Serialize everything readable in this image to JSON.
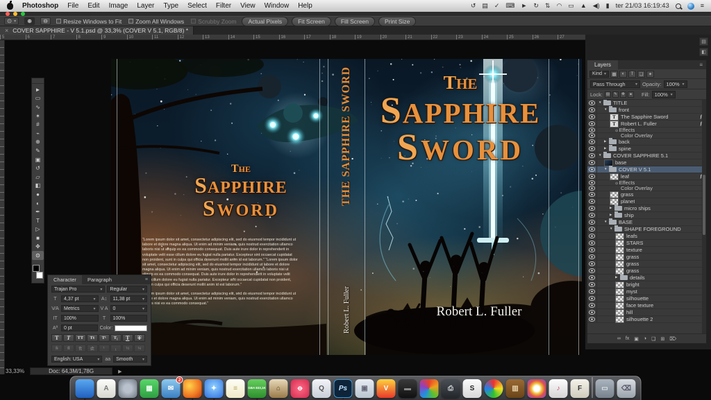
{
  "menubar": {
    "items": [
      {
        "label": "Photoshop",
        "cls": "bold"
      },
      {
        "label": "File",
        "cls": ""
      },
      {
        "label": "Edit",
        "cls": ""
      },
      {
        "label": "Image",
        "cls": ""
      },
      {
        "label": "Layer",
        "cls": ""
      },
      {
        "label": "Type",
        "cls": ""
      },
      {
        "label": "Select",
        "cls": ""
      },
      {
        "label": "Filter",
        "cls": ""
      },
      {
        "label": "View",
        "cls": ""
      },
      {
        "label": "Window",
        "cls": ""
      },
      {
        "label": "Help",
        "cls": ""
      }
    ],
    "status_icons": [
      {
        "name": "time-machine-icon",
        "glyph": "↺"
      },
      {
        "name": "display-icon",
        "glyph": "▤"
      },
      {
        "name": "dropbox-icon",
        "glyph": "✓"
      },
      {
        "name": "keyboard-icon",
        "glyph": "⌨"
      },
      {
        "name": "pointer-icon",
        "glyph": "►"
      },
      {
        "name": "sync-icon",
        "glyph": "↻"
      },
      {
        "name": "updown-icon",
        "glyph": "⇅"
      },
      {
        "name": "wifi-icon",
        "glyph": "◠"
      },
      {
        "name": "screen-share-icon",
        "glyph": "▭"
      },
      {
        "name": "eject-icon",
        "glyph": "▲"
      },
      {
        "name": "volume-icon",
        "glyph": "◀)"
      },
      {
        "name": "battery-icon",
        "glyph": "▮"
      }
    ],
    "clock": "ter 21/03 16:19:43",
    "notification_glyph": "≡"
  },
  "options": {
    "tool_glyph": "⊙",
    "zoom_in_glyph": "⊕",
    "zoom_out_glyph": "⊖",
    "checkboxes": [
      {
        "label": "Resize Windows to Fit",
        "cls": ""
      },
      {
        "label": "Zoom All Windows",
        "cls": ""
      },
      {
        "label": "Scrubby Zoom",
        "cls": "dim"
      }
    ],
    "buttons": [
      {
        "label": "Actual Pixels"
      },
      {
        "label": "Fit Screen"
      },
      {
        "label": "Fill Screen"
      },
      {
        "label": "Print Size"
      }
    ]
  },
  "tab": {
    "close": "×",
    "title": "COVER SAPPHIRE - V 5.1.psd @ 33,3% (COVER V 5.1, RGB/8) *"
  },
  "ruler": {
    "numbers": [
      "5",
      "6",
      "7",
      "8",
      "9",
      "10",
      "11",
      "12",
      "13",
      "14",
      "15",
      "16",
      "17",
      "18",
      "19",
      "20",
      "21",
      "22",
      "23",
      "24",
      "25",
      "26",
      "27"
    ]
  },
  "toolbar": {
    "tools": [
      {
        "name": "move-tool",
        "glyph": "►",
        "cls": ""
      },
      {
        "name": "marquee-tool",
        "glyph": "▭",
        "cls": ""
      },
      {
        "name": "lasso-tool",
        "glyph": "∿",
        "cls": ""
      },
      {
        "name": "quick-select-tool",
        "glyph": "✶",
        "cls": ""
      },
      {
        "name": "crop-tool",
        "glyph": "#",
        "cls": ""
      },
      {
        "name": "eyedropper-tool",
        "glyph": "⌁",
        "cls": ""
      },
      {
        "name": "healing-brush-tool",
        "glyph": "⊕",
        "cls": ""
      },
      {
        "name": "brush-tool",
        "glyph": "✎",
        "cls": ""
      },
      {
        "name": "clone-stamp-tool",
        "glyph": "▣",
        "cls": ""
      },
      {
        "name": "history-brush-tool",
        "glyph": "↺",
        "cls": ""
      },
      {
        "name": "eraser-tool",
        "glyph": "▱",
        "cls": ""
      },
      {
        "name": "gradient-tool",
        "glyph": "◧",
        "cls": ""
      },
      {
        "name": "blur-tool",
        "glyph": "●",
        "cls": ""
      },
      {
        "name": "dodge-tool",
        "glyph": "◐",
        "cls": ""
      },
      {
        "name": "pen-tool",
        "glyph": "✒",
        "cls": ""
      },
      {
        "name": "type-tool",
        "glyph": "T",
        "cls": ""
      },
      {
        "name": "path-select-tool",
        "glyph": "▷",
        "cls": ""
      },
      {
        "name": "shape-tool",
        "glyph": "■",
        "cls": ""
      },
      {
        "name": "hand-tool",
        "glyph": "✥",
        "cls": ""
      },
      {
        "name": "zoom-tool",
        "glyph": "⊙",
        "cls": "active"
      }
    ]
  },
  "cover": {
    "front": {
      "the": "THE",
      "title1": "SAPPHIRE",
      "title2": "SWORD",
      "author": "Robert L. Fuller"
    },
    "back": {
      "the": "THE",
      "title1": "SAPPHIRE",
      "title2": "SWORD",
      "body_p1": "“Lorem ipsum dolor sit amet, consectetur adipiscing elit, sed do eiusmod tempor incididunt ut labore et dolore magna aliqua. Ut enim ad minim veniam, quis nostrud exercitation ullamco laboris nisi ut aliquip ex ea commodo consequat. Duis aute irure dolor in reprehenderit in voluptate velit esse cillum dolore eu fugiat nulla pariatur. Excepteur sint occaecat cupidatat non proident, sunt in culpa qui officia deserunt mollit anim id est laborum.” “Lorem ipsum dolor sit amet, consectetur adipiscing elit, sed do eiusmod tempor incididunt ut labore et dolore magna aliqua. Ut enim ad minim veniam, quis nostrud exercitation ullamco laboris nisi ut aliquip ex ea commodo consequat. Duis aute irure dolor in reprehenderit in voluptate velit esse cillum dolore eu fugiat nulla pariatur. Excepteur sint occaecat cupidatat non proident, sunt in culpa qui officia deserunt mollit anim id est laborum.”",
      "body_p2": "“Lorem ipsum dolor sit amet, consectetur adipiscing elit, sed do eiusmod tempor incididunt ut labore et dolore magna aliqua. Ut enim ad minim veniam, quis nostrud exercitation ullamco laboris nisi ex ea commodo consequat.”"
    },
    "spine": {
      "title": "THE SAPPHIRE SWORD",
      "author": "Robert L. Fuller"
    }
  },
  "character_panel": {
    "tab_character": "Character",
    "tab_paragraph": "Paragraph",
    "font_family": "Trajan Pro",
    "font_style": "Regular",
    "size": "4,37 pt",
    "leading": "11,38 pt",
    "kerning": "Metrics",
    "tracking": "0",
    "v_scale": "100%",
    "h_scale": "100%",
    "baseline": "0 pt",
    "color_label": "Color:",
    "language": "English: USA",
    "antialias_label": "aa",
    "antialias": "Smooth",
    "toggles_row1": [
      {
        "g": "T",
        "cls": ""
      },
      {
        "g": "T",
        "cls": "i"
      },
      {
        "g": "TT",
        "cls": "sm"
      },
      {
        "g": "Tt",
        "cls": "sm"
      },
      {
        "g": "T¹",
        "cls": "sm"
      },
      {
        "g": "T₁",
        "cls": "sm"
      },
      {
        "g": "T",
        "cls": "u"
      },
      {
        "g": "T",
        "cls": "s"
      }
    ],
    "toggles_row2": [
      {
        "g": "ﬁ",
        "cls": "dim sm"
      },
      {
        "g": "ﬂ",
        "cls": "dim sm"
      },
      {
        "g": "ﬅ",
        "cls": "dim sm"
      },
      {
        "g": "ﬆ",
        "cls": "dim sm"
      },
      {
        "g": "¹",
        "cls": "dim sm"
      },
      {
        "g": "₁",
        "cls": "dim sm"
      },
      {
        "g": "½",
        "cls": "dim sm"
      },
      {
        "g": "¼",
        "cls": "dim sm"
      }
    ]
  },
  "layers_panel": {
    "tab": "Layers",
    "menu_glyph": "≡",
    "filter_label": "Kind",
    "filter_icons": [
      {
        "name": "filter-pixel-icon",
        "glyph": "▩"
      },
      {
        "name": "filter-adjustment-icon",
        "glyph": "◐"
      },
      {
        "name": "filter-type-icon",
        "glyph": "T"
      },
      {
        "name": "filter-shape-icon",
        "glyph": "❏"
      },
      {
        "name": "filter-smart-icon",
        "glyph": "✦"
      }
    ],
    "blend_mode": "Pass Through",
    "opacity_label": "Opacity:",
    "opacity": "100%",
    "lock_label": "Lock:",
    "lock_icons": [
      {
        "name": "lock-transparent-icon",
        "glyph": "▨"
      },
      {
        "name": "lock-pixels-icon",
        "glyph": "✎"
      },
      {
        "name": "lock-position-icon",
        "glyph": "✥"
      },
      {
        "name": "lock-all-icon",
        "glyph": "∎"
      }
    ],
    "fill_label": "Fill:",
    "fill": "100%",
    "fx_label": "fx",
    "rows": [
      {
        "label": "TITLE",
        "lv": "lv0",
        "kind": "group-open",
        "fx": "",
        "sel": ""
      },
      {
        "label": "front",
        "lv": "lv1",
        "kind": "group-open",
        "fx": "",
        "sel": ""
      },
      {
        "label": "The Sapphire Sword",
        "lv": "lv2",
        "kind": "text",
        "fx": "hasfx",
        "sel": ""
      },
      {
        "label": "Robert L. Fuller",
        "lv": "lv2",
        "kind": "text",
        "fx": "hasfx",
        "sel": ""
      },
      {
        "label": "Effects",
        "lv": "lv3",
        "kind": "effects",
        "fx": "",
        "sel": ""
      },
      {
        "label": "Color Overlay",
        "lv": "lv4",
        "kind": "overlay",
        "fx": "",
        "sel": ""
      },
      {
        "label": "back",
        "lv": "lv1",
        "kind": "group-closed",
        "fx": "",
        "sel": ""
      },
      {
        "label": "spine",
        "lv": "lv1",
        "kind": "group-closed",
        "fx": "",
        "sel": ""
      },
      {
        "label": "COVER SAPPHIRE 5.1",
        "lv": "lv0",
        "kind": "group-open",
        "fx": "",
        "sel": ""
      },
      {
        "label": "base",
        "lv": "lv1",
        "kind": "image",
        "fx": "",
        "sel": ""
      },
      {
        "label": "COVER V 5.1",
        "lv": "lv1",
        "kind": "group-open",
        "fx": "",
        "sel": "selected"
      },
      {
        "label": "leaf",
        "lv": "lv2",
        "kind": "thumb",
        "fx": "hasfx",
        "sel": ""
      },
      {
        "label": "Effects",
        "lv": "lv3",
        "kind": "effects",
        "fx": "",
        "sel": ""
      },
      {
        "label": "Color Overlay",
        "lv": "lv4",
        "kind": "overlay",
        "fx": "",
        "sel": ""
      },
      {
        "label": "grass",
        "lv": "lv2",
        "kind": "thumb",
        "fx": "",
        "sel": ""
      },
      {
        "label": "planet",
        "lv": "lv2",
        "kind": "thumb",
        "fx": "",
        "sel": ""
      },
      {
        "label": "micro ships",
        "lv": "lv2",
        "kind": "group-closed",
        "fx": "",
        "sel": ""
      },
      {
        "label": "ship",
        "lv": "lv2",
        "kind": "group-closed",
        "fx": "",
        "sel": ""
      },
      {
        "label": "BASE",
        "lv": "lv1",
        "kind": "group-open",
        "fx": "",
        "sel": ""
      },
      {
        "label": "SHAPE FOREGROUND",
        "lv": "lv2",
        "kind": "group-open",
        "fx": "",
        "sel": ""
      },
      {
        "label": "leafs",
        "lv": "lv3",
        "kind": "thumb",
        "fx": "",
        "sel": ""
      },
      {
        "label": "STARS",
        "lv": "lv3",
        "kind": "thumb",
        "fx": "",
        "sel": ""
      },
      {
        "label": "texture",
        "lv": "lv3",
        "kind": "thumb",
        "fx": "",
        "sel": ""
      },
      {
        "label": "grass",
        "lv": "lv3",
        "kind": "thumb",
        "fx": "",
        "sel": ""
      },
      {
        "label": "grass",
        "lv": "lv3",
        "kind": "thumb",
        "fx": "",
        "sel": ""
      },
      {
        "label": "grass",
        "lv": "lv3",
        "kind": "thumb",
        "fx": "",
        "sel": ""
      },
      {
        "label": "details",
        "lv": "lv3",
        "kind": "group-closed",
        "fx": "",
        "sel": ""
      },
      {
        "label": "bright",
        "lv": "lv3",
        "kind": "thumb",
        "fx": "",
        "sel": ""
      },
      {
        "label": "myst",
        "lv": "lv3",
        "kind": "thumb",
        "fx": "",
        "sel": ""
      },
      {
        "label": "silhouette",
        "lv": "lv3",
        "kind": "thumb",
        "fx": "",
        "sel": ""
      },
      {
        "label": "face texture",
        "lv": "lv3",
        "kind": "thumb",
        "fx": "",
        "sel": ""
      },
      {
        "label": "hill",
        "lv": "lv3",
        "kind": "thumb",
        "fx": "",
        "sel": ""
      },
      {
        "label": "silhouette 2",
        "lv": "lv3",
        "kind": "thumb",
        "fx": "",
        "sel": ""
      }
    ],
    "bottom_icons": [
      {
        "name": "link-layers-icon",
        "glyph": "∞"
      },
      {
        "name": "layer-style-icon",
        "glyph": "fx"
      },
      {
        "name": "layer-mask-icon",
        "glyph": "▣"
      },
      {
        "name": "adjustment-layer-icon",
        "glyph": "◑"
      },
      {
        "name": "layer-group-icon",
        "glyph": "❏"
      },
      {
        "name": "new-layer-icon",
        "glyph": "⊞"
      },
      {
        "name": "delete-layer-icon",
        "glyph": "⌦"
      }
    ]
  },
  "statusbar": {
    "zoom": "33,33%",
    "doc": "Doc: 64,3M/1,78G",
    "arrow": "▶"
  },
  "dock": {
    "apps": [
      {
        "name": "finder",
        "color": "linear-gradient(180deg,#5aa8f0,#2060c0)",
        "glyph": "",
        "gcolor": "#fff",
        "cls": "running",
        "badge": ""
      },
      {
        "name": "textedit",
        "color": "linear-gradient(180deg,#fdfdfb,#d8d8d0)",
        "glyph": "A",
        "gcolor": "#777",
        "cls": "",
        "badge": ""
      },
      {
        "name": "launchpad",
        "color": "radial-gradient(circle,#b9c2cc 30%,#6a737d)",
        "glyph": "",
        "gcolor": "#333",
        "cls": "",
        "badge": ""
      },
      {
        "name": "dashboard",
        "color": "linear-gradient(180deg,#59d66a,#2f9e42)",
        "glyph": "▦",
        "gcolor": "#eafff0",
        "cls": "",
        "badge": ""
      },
      {
        "name": "mail",
        "color": "linear-gradient(180deg,#8ec9ee,#3a7fc2)",
        "glyph": "✉",
        "gcolor": "#fff",
        "cls": "running",
        "badge": "2"
      },
      {
        "name": "firefox",
        "color": "radial-gradient(circle at 35% 35%,#ffd24a,#f07522 60%,#b33a12)",
        "glyph": "",
        "gcolor": "#fff",
        "cls": "running",
        "badge": ""
      },
      {
        "name": "safari",
        "color": "radial-gradient(circle at 50% 40%,#8fd0ff,#2f6fe0)",
        "glyph": "✦",
        "gcolor": "#fff",
        "cls": "running",
        "badge": ""
      },
      {
        "name": "notes",
        "color": "linear-gradient(180deg,#fffef5,#efe9c8)",
        "glyph": "≡",
        "gcolor": "#b8a860",
        "cls": "",
        "badge": ""
      },
      {
        "name": "net-meter",
        "color": "linear-gradient(180deg,#66cf5e,#2e8f2e)",
        "glyph": "GBA 833,1K",
        "gcolor": "#fff",
        "cls": "tiny running",
        "badge": ""
      },
      {
        "name": "artrage",
        "color": "linear-gradient(180deg,#e8d9b8,#9a7a4a)",
        "glyph": "⌂",
        "gcolor": "#5a4020",
        "cls": "",
        "badge": ""
      },
      {
        "name": "red-swirl-app",
        "color": "radial-gradient(circle,#ff6a86,#d22a4e)",
        "glyph": "ꝋ",
        "gcolor": "#fff",
        "cls": "",
        "badge": ""
      },
      {
        "name": "quicktime",
        "color": "linear-gradient(180deg,#f2f4f8,#c9cfd8)",
        "glyph": "Q",
        "gcolor": "#555",
        "cls": "",
        "badge": ""
      },
      {
        "name": "photoshop",
        "color": "#0e2438",
        "glyph": "Ps",
        "gcolor": "#bfe3ff",
        "cls": "ps running",
        "badge": ""
      },
      {
        "name": "preview",
        "color": "linear-gradient(180deg,#e8edf2,#b9c4cf)",
        "glyph": "▣",
        "gcolor": "#667",
        "cls": "",
        "badge": ""
      },
      {
        "name": "v-app",
        "color": "linear-gradient(180deg,#ffd23e,#e8392a)",
        "glyph": "V",
        "gcolor": "#fff",
        "cls": "",
        "badge": ""
      },
      {
        "name": "black-device-app",
        "color": "linear-gradient(180deg,#3a3a3a,#101010)",
        "glyph": "▬",
        "gcolor": "#888",
        "cls": "",
        "badge": ""
      },
      {
        "name": "pixel-grid-app",
        "color": "conic-gradient(#e8402a,#f0a020,#58c030,#2090e0,#9040c0,#e8402a)",
        "glyph": "",
        "gcolor": "#fff",
        "cls": "",
        "badge": ""
      },
      {
        "name": "printer",
        "color": "linear-gradient(180deg,#4a4f55,#23272c)",
        "glyph": "⎙",
        "gcolor": "#cfd4d8",
        "cls": "",
        "badge": ""
      },
      {
        "name": "clip-studio",
        "color": "linear-gradient(180deg,#fcfcfc,#d8d8d8)",
        "glyph": "S",
        "gcolor": "#222",
        "cls": "",
        "badge": ""
      },
      {
        "name": "colorsync",
        "color": "conic-gradient(#f03030,#f0e020,#30c030,#2080f0,#f03030)",
        "glyph": "",
        "gcolor": "#fff",
        "cls": "round",
        "badge": ""
      },
      {
        "name": "box-app",
        "color": "linear-gradient(180deg,#9a6a34,#6a4418)",
        "glyph": "▥",
        "gcolor": "#e8d0a8",
        "cls": "",
        "badge": ""
      },
      {
        "name": "photos",
        "color": "radial-gradient(circle,#ffffff 22%,#f0c030 40%,#e05050 62%,#7050d0)",
        "glyph": "✿",
        "gcolor": "#fff",
        "cls": "",
        "badge": ""
      },
      {
        "name": "itunes",
        "color": "linear-gradient(180deg,#fdfdfd,#d5d5d5)",
        "glyph": "♪",
        "gcolor": "#d04868",
        "cls": "",
        "badge": ""
      },
      {
        "name": "fontbook",
        "color": "linear-gradient(180deg,#f5f3ea,#cfcabc)",
        "glyph": "F",
        "gcolor": "#333",
        "cls": "",
        "badge": ""
      },
      {
        "name": "dock-divider",
        "color": "rgba(250,252,255,.55)",
        "glyph": "",
        "gcolor": "#000",
        "cls": "divider",
        "badge": ""
      },
      {
        "name": "minimized-window",
        "color": "linear-gradient(180deg,#aab4be,#78828c)",
        "glyph": "▭",
        "gcolor": "#dde4ea",
        "cls": "",
        "badge": ""
      },
      {
        "name": "trash",
        "color": "linear-gradient(180deg,#d8dde2,#9aa2aa)",
        "glyph": "⌫",
        "gcolor": "#556",
        "cls": "",
        "badge": ""
      }
    ]
  },
  "right_dock": {
    "collapse_glyph": "«",
    "mini_icons": [
      {
        "name": "collapsed-color-panel-icon",
        "glyph": "▤"
      },
      {
        "name": "collapsed-swatches-panel-icon",
        "glyph": "◧"
      }
    ]
  }
}
